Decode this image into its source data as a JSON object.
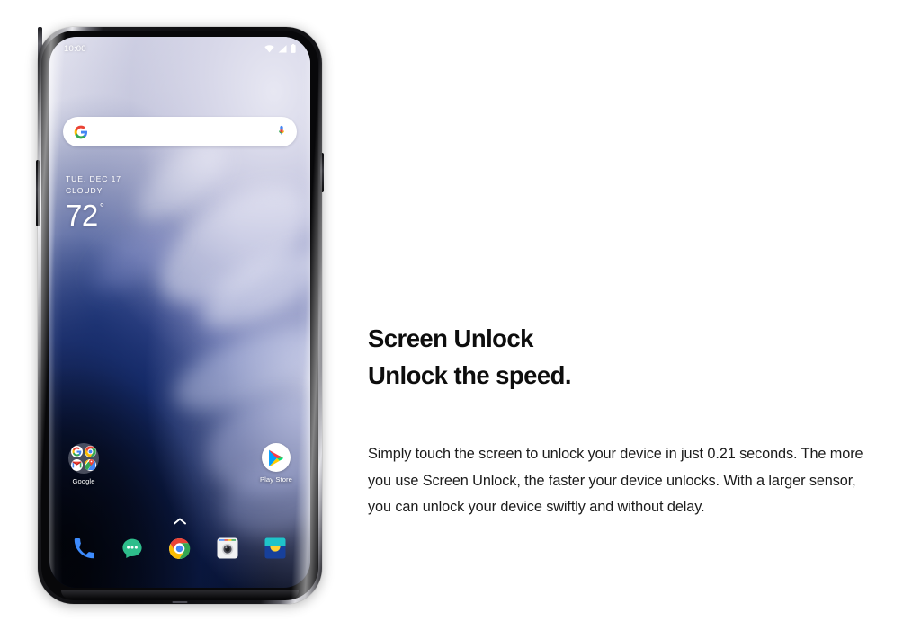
{
  "page": {
    "background": "#ffffff"
  },
  "phone": {
    "device_name": "oneplus-7-pro",
    "frame_color": "#0a0a0c",
    "screen": {
      "statusbar": {
        "time": "10:00",
        "icons": [
          "wifi-icon",
          "signal-icon",
          "battery-icon"
        ]
      },
      "search": {
        "logo": "google-g-icon",
        "value": "",
        "placeholder": "",
        "mic": "microphone-icon"
      },
      "weather": {
        "date": "TUE, DEC 17",
        "condition": "CLOUDY",
        "temperature": "72",
        "degree": "°"
      },
      "apps": [
        {
          "label": "Google",
          "type": "folder",
          "icon": "google-folder-icon",
          "contents": [
            "google-g-icon",
            "chrome-icon",
            "gmail-icon",
            "maps-icon"
          ]
        },
        {
          "label": "Play Store",
          "type": "app",
          "icon": "play-store-icon"
        }
      ],
      "drawer_handle": "chevron-up-icon",
      "dock": [
        {
          "label": "Phone",
          "icon": "phone-icon",
          "color": "#3d8bfd"
        },
        {
          "label": "Messages",
          "icon": "messages-icon",
          "color": "#2ebd8b"
        },
        {
          "label": "Chrome",
          "icon": "chrome-icon",
          "color": "#4285f4"
        },
        {
          "label": "Camera",
          "icon": "camera-icon",
          "color": "#f1f1f1"
        },
        {
          "label": "Gallery",
          "icon": "gallery-icon",
          "color": "#1b4da8"
        }
      ]
    },
    "hardware": {
      "volume_button": "volume-rocker",
      "power_button": "power-button",
      "alert_slider": "alert-slider",
      "port": "usb-c-port"
    }
  },
  "copy": {
    "headline_line1": "Screen Unlock",
    "headline_line2": "Unlock the speed.",
    "body": "Simply touch the screen to unlock your device in just 0.21 seconds. The more you use Screen Unlock, the faster your device unlocks. With a larger sensor, you can unlock your device swiftly and without delay."
  }
}
